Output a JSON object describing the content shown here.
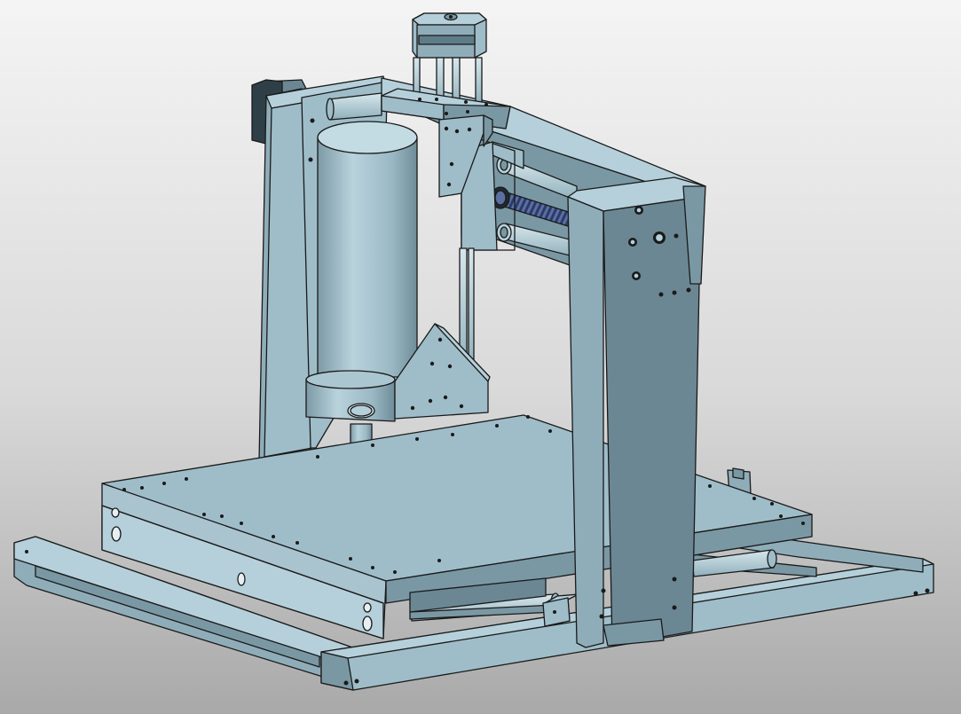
{
  "viewport": {
    "background_top": "#f4f4f4",
    "background_bottom": "#a9a9a9"
  },
  "model": {
    "colors": {
      "body": "#9fbdc9",
      "light": "#b5d0da",
      "dark": "#7a98a4",
      "darker": "#6b8793",
      "edge": "#1a1a1a",
      "screw": "#2b3a6a"
    }
  }
}
